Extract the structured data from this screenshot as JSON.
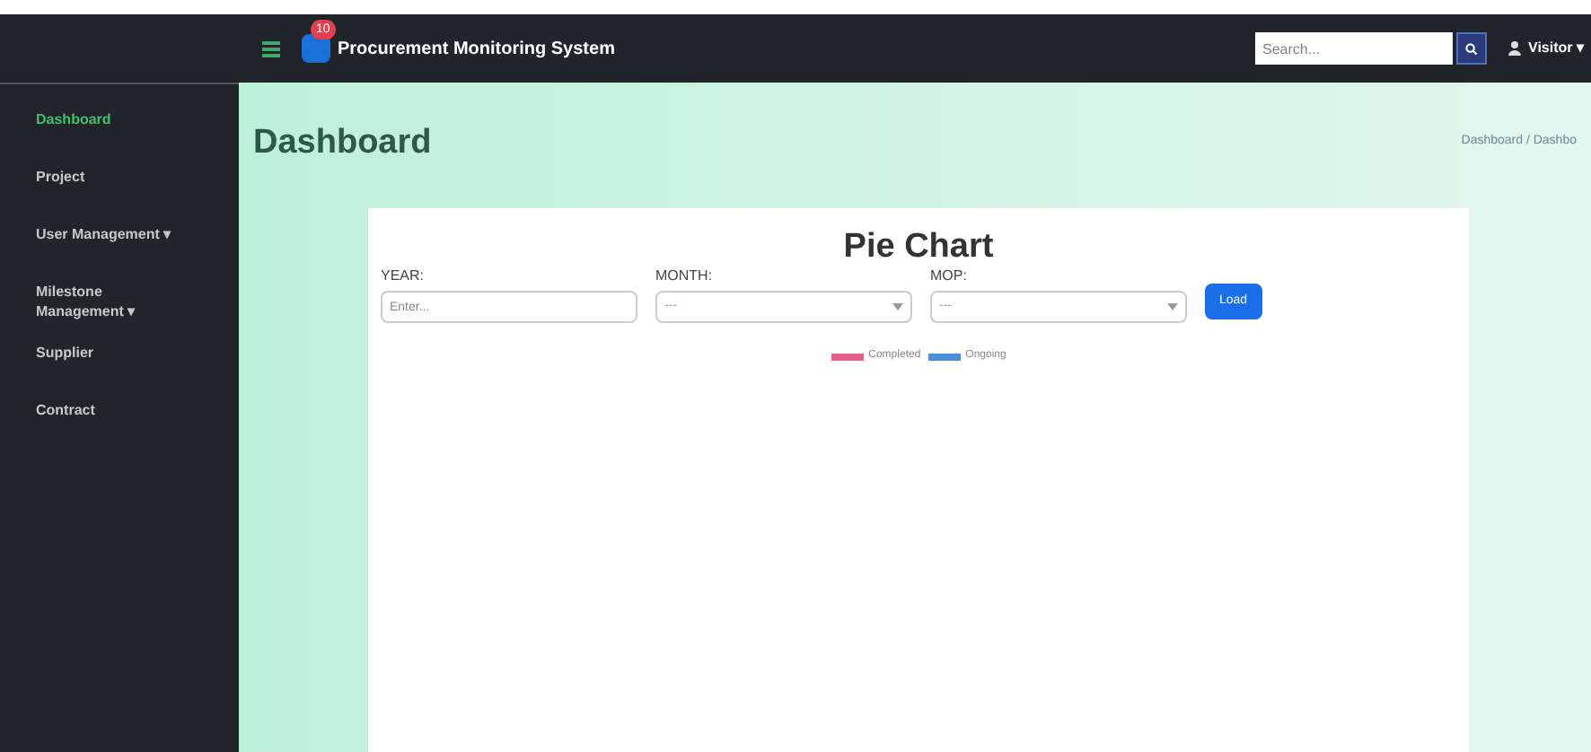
{
  "navbar": {
    "brand": "Procurement Monitoring System",
    "notification_count": "10",
    "search": {
      "placeholder": "Search..."
    },
    "user": "Visitor ▾"
  },
  "sidebar": {
    "items": [
      {
        "label": "Dashboard",
        "selected": true
      },
      {
        "label": "Project",
        "selected": false
      },
      {
        "label": "User Management ▾",
        "selected": false
      },
      {
        "label": "Milestone Management ▾",
        "selected": false
      },
      {
        "label": "Supplier",
        "selected": false
      },
      {
        "label": "Contract",
        "selected": false
      }
    ]
  },
  "page": {
    "title": "Dashboard",
    "breadcrumb": "Dashboard / Dashbo"
  },
  "card": {
    "title": "Pie Chart",
    "filters": [
      {
        "label": "YEAR:",
        "kind": "input",
        "placeholder": "Enter..."
      },
      {
        "label": "MONTH:",
        "kind": "select",
        "value": "---"
      },
      {
        "label": "MOP:",
        "kind": "select",
        "value": "---"
      }
    ],
    "button": "Load",
    "legend": [
      {
        "label": "Completed",
        "color": "#e0608a"
      },
      {
        "label": "Ongoing",
        "color": "#4a90d9"
      }
    ]
  }
}
